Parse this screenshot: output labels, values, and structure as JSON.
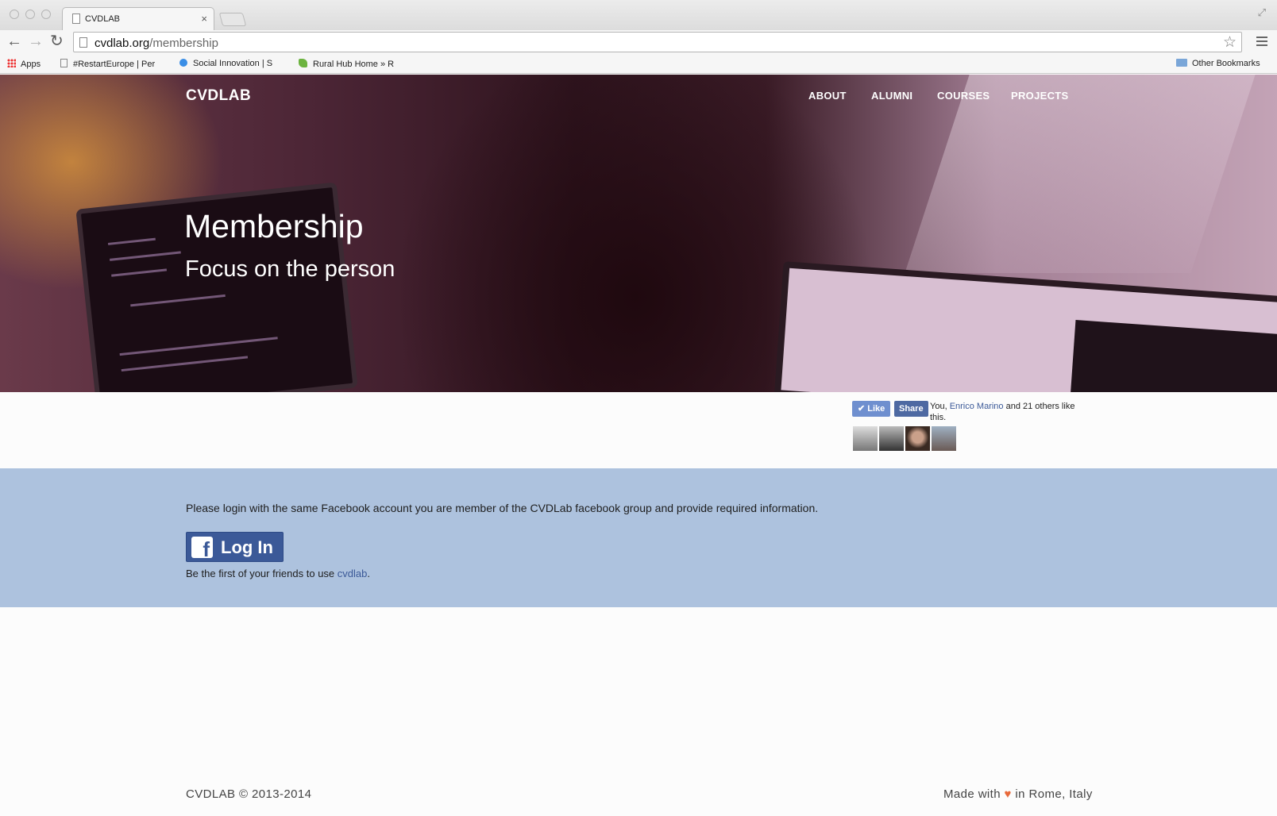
{
  "browser": {
    "tab_title": "CVDLAB",
    "tab_close": "×",
    "url_host": "cvdlab.org",
    "url_path": "/membership",
    "bookmarks": [
      {
        "label": "Apps",
        "icon": "apps-grid-icon"
      },
      {
        "label": "#RestartEurope | Per",
        "icon": "page-icon"
      },
      {
        "label": "Social Innovation | S",
        "icon": "globe-icon"
      },
      {
        "label": "Rural Hub Home » R",
        "icon": "leaf-icon"
      }
    ],
    "other_bookmarks": "Other Bookmarks"
  },
  "site": {
    "logo": "CVDLAB",
    "nav": [
      "ABOUT",
      "ALUMNI",
      "COURSES",
      "PROJECTS"
    ]
  },
  "hero": {
    "title": "Membership",
    "subtitle": "Focus on the person"
  },
  "fb_like": {
    "like": "Like",
    "share": "Share",
    "text_prefix": "You, ",
    "friend_name": "Enrico Marino",
    "text_suffix": " and 21 others like this."
  },
  "login": {
    "message": "Please login with the same Facebook account you are member of the CVDLab facebook group and provide required information.",
    "button_label": "Log In",
    "friends_prefix": "Be the first of your friends to use ",
    "friends_link": "cvdlab",
    "friends_suffix": "."
  },
  "footer": {
    "copyright": "CVDLAB © 2013-2014",
    "made_prefix": "Made with ",
    "heart": "♥",
    "made_suffix": " in Rome, Italy"
  },
  "colors": {
    "login_band": "#adc2de",
    "facebook_blue": "#3b5998",
    "heart": "#e8693a"
  }
}
